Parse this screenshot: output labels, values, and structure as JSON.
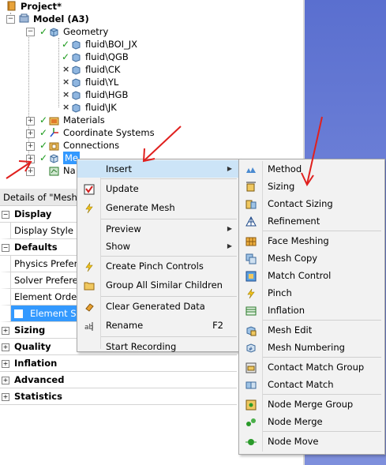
{
  "tree": {
    "project": "Project*",
    "model": "Model (A3)",
    "geometry": "Geometry",
    "bodies": [
      "fluid\\BOI_JX",
      "fluid\\QGB",
      "fluid\\CK",
      "fluid\\YL",
      "fluid\\HGB",
      "fluid\\JK"
    ],
    "materials": "Materials",
    "coordinate_systems": "Coordinate Systems",
    "connections": "Connections",
    "mesh": "Me",
    "named": "Na"
  },
  "details": {
    "title": "Details of \"Mesh",
    "rows": [
      {
        "label": "Display",
        "type": "section",
        "sign": "−"
      },
      {
        "label": "Display Style",
        "type": "item"
      },
      {
        "label": "Defaults",
        "type": "section",
        "sign": "−"
      },
      {
        "label": "Physics Prefere",
        "type": "item"
      },
      {
        "label": "Solver Preferen",
        "type": "item"
      },
      {
        "label": "Element Order",
        "type": "item"
      },
      {
        "label": "Element Siz",
        "type": "selected"
      },
      {
        "label": "Sizing",
        "type": "section",
        "sign": "+"
      },
      {
        "label": "Quality",
        "type": "section",
        "sign": "+"
      },
      {
        "label": "Inflation",
        "type": "section",
        "sign": "+"
      },
      {
        "label": "Advanced",
        "type": "section",
        "sign": "+"
      },
      {
        "label": "Statistics",
        "type": "section",
        "sign": "+"
      }
    ]
  },
  "context_menu": {
    "items": [
      {
        "label": "Insert",
        "submenu": true,
        "icon": "none"
      },
      {
        "label": "Update",
        "icon": "update-icon"
      },
      {
        "label": "Generate Mesh",
        "icon": "lightning-icon"
      },
      {
        "label": "Preview",
        "submenu": true,
        "icon": "none"
      },
      {
        "label": "Show",
        "submenu": true,
        "icon": "none"
      },
      {
        "label": "Create Pinch Controls",
        "icon": "lightning-icon"
      },
      {
        "label": "Group All Similar Children",
        "icon": "folder-icon"
      },
      {
        "label": "Clear Generated Data",
        "icon": "eraser-icon"
      },
      {
        "label": "Rename",
        "shortcut": "F2",
        "icon": "rename-icon"
      },
      {
        "label": "Start Recording",
        "icon": "none"
      }
    ]
  },
  "insert_submenu": {
    "items": [
      {
        "label": "Method",
        "icon": "method-icon"
      },
      {
        "label": "Sizing",
        "icon": "sizing-icon"
      },
      {
        "label": "Contact Sizing",
        "icon": "contact-sizing-icon"
      },
      {
        "label": "Refinement",
        "icon": "refinement-icon"
      },
      {
        "label": "Face Meshing",
        "icon": "face-meshing-icon"
      },
      {
        "label": "Mesh Copy",
        "icon": "mesh-copy-icon"
      },
      {
        "label": "Match Control",
        "icon": "match-control-icon"
      },
      {
        "label": "Pinch",
        "icon": "pinch-icon"
      },
      {
        "label": "Inflation",
        "icon": "inflation-icon"
      },
      {
        "label": "Mesh Edit",
        "icon": "mesh-edit-icon"
      },
      {
        "label": "Mesh Numbering",
        "icon": "mesh-numbering-icon"
      },
      {
        "label": "Contact Match Group",
        "icon": "contact-match-group-icon"
      },
      {
        "label": "Contact Match",
        "icon": "contact-match-icon"
      },
      {
        "label": "Node Merge Group",
        "icon": "node-merge-group-icon"
      },
      {
        "label": "Node Merge",
        "icon": "node-merge-icon"
      },
      {
        "label": "Node Move",
        "icon": "node-move-icon"
      }
    ]
  },
  "colors": {
    "highlight": "#cce4f7",
    "selected": "#3399ff",
    "annotation_arrow": "#e0201e",
    "background_blue": "#6f82d8"
  }
}
